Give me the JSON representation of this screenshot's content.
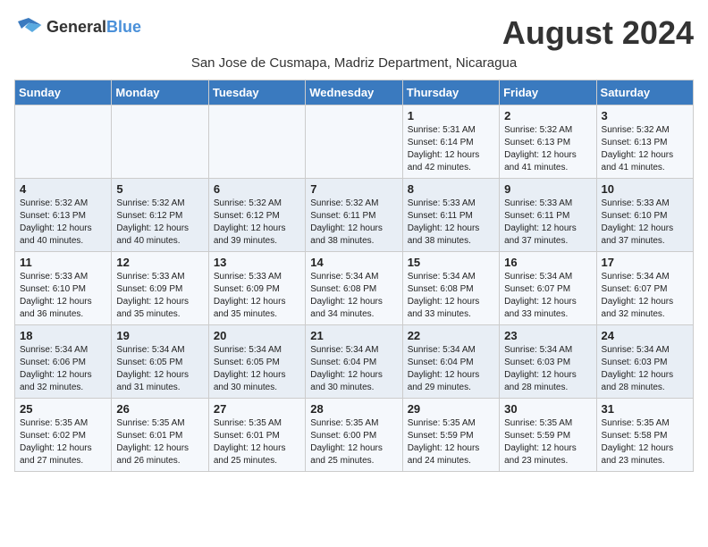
{
  "header": {
    "logo_general": "General",
    "logo_blue": "Blue",
    "month_title": "August 2024",
    "subtitle": "San Jose de Cusmapa, Madriz Department, Nicaragua"
  },
  "days_of_week": [
    "Sunday",
    "Monday",
    "Tuesday",
    "Wednesday",
    "Thursday",
    "Friday",
    "Saturday"
  ],
  "weeks": [
    [
      {
        "day": "",
        "info": ""
      },
      {
        "day": "",
        "info": ""
      },
      {
        "day": "",
        "info": ""
      },
      {
        "day": "",
        "info": ""
      },
      {
        "day": "1",
        "info": "Sunrise: 5:31 AM\nSunset: 6:14 PM\nDaylight: 12 hours\nand 42 minutes."
      },
      {
        "day": "2",
        "info": "Sunrise: 5:32 AM\nSunset: 6:13 PM\nDaylight: 12 hours\nand 41 minutes."
      },
      {
        "day": "3",
        "info": "Sunrise: 5:32 AM\nSunset: 6:13 PM\nDaylight: 12 hours\nand 41 minutes."
      }
    ],
    [
      {
        "day": "4",
        "info": "Sunrise: 5:32 AM\nSunset: 6:13 PM\nDaylight: 12 hours\nand 40 minutes."
      },
      {
        "day": "5",
        "info": "Sunrise: 5:32 AM\nSunset: 6:12 PM\nDaylight: 12 hours\nand 40 minutes."
      },
      {
        "day": "6",
        "info": "Sunrise: 5:32 AM\nSunset: 6:12 PM\nDaylight: 12 hours\nand 39 minutes."
      },
      {
        "day": "7",
        "info": "Sunrise: 5:32 AM\nSunset: 6:11 PM\nDaylight: 12 hours\nand 38 minutes."
      },
      {
        "day": "8",
        "info": "Sunrise: 5:33 AM\nSunset: 6:11 PM\nDaylight: 12 hours\nand 38 minutes."
      },
      {
        "day": "9",
        "info": "Sunrise: 5:33 AM\nSunset: 6:11 PM\nDaylight: 12 hours\nand 37 minutes."
      },
      {
        "day": "10",
        "info": "Sunrise: 5:33 AM\nSunset: 6:10 PM\nDaylight: 12 hours\nand 37 minutes."
      }
    ],
    [
      {
        "day": "11",
        "info": "Sunrise: 5:33 AM\nSunset: 6:10 PM\nDaylight: 12 hours\nand 36 minutes."
      },
      {
        "day": "12",
        "info": "Sunrise: 5:33 AM\nSunset: 6:09 PM\nDaylight: 12 hours\nand 35 minutes."
      },
      {
        "day": "13",
        "info": "Sunrise: 5:33 AM\nSunset: 6:09 PM\nDaylight: 12 hours\nand 35 minutes."
      },
      {
        "day": "14",
        "info": "Sunrise: 5:34 AM\nSunset: 6:08 PM\nDaylight: 12 hours\nand 34 minutes."
      },
      {
        "day": "15",
        "info": "Sunrise: 5:34 AM\nSunset: 6:08 PM\nDaylight: 12 hours\nand 33 minutes."
      },
      {
        "day": "16",
        "info": "Sunrise: 5:34 AM\nSunset: 6:07 PM\nDaylight: 12 hours\nand 33 minutes."
      },
      {
        "day": "17",
        "info": "Sunrise: 5:34 AM\nSunset: 6:07 PM\nDaylight: 12 hours\nand 32 minutes."
      }
    ],
    [
      {
        "day": "18",
        "info": "Sunrise: 5:34 AM\nSunset: 6:06 PM\nDaylight: 12 hours\nand 32 minutes."
      },
      {
        "day": "19",
        "info": "Sunrise: 5:34 AM\nSunset: 6:05 PM\nDaylight: 12 hours\nand 31 minutes."
      },
      {
        "day": "20",
        "info": "Sunrise: 5:34 AM\nSunset: 6:05 PM\nDaylight: 12 hours\nand 30 minutes."
      },
      {
        "day": "21",
        "info": "Sunrise: 5:34 AM\nSunset: 6:04 PM\nDaylight: 12 hours\nand 30 minutes."
      },
      {
        "day": "22",
        "info": "Sunrise: 5:34 AM\nSunset: 6:04 PM\nDaylight: 12 hours\nand 29 minutes."
      },
      {
        "day": "23",
        "info": "Sunrise: 5:34 AM\nSunset: 6:03 PM\nDaylight: 12 hours\nand 28 minutes."
      },
      {
        "day": "24",
        "info": "Sunrise: 5:34 AM\nSunset: 6:03 PM\nDaylight: 12 hours\nand 28 minutes."
      }
    ],
    [
      {
        "day": "25",
        "info": "Sunrise: 5:35 AM\nSunset: 6:02 PM\nDaylight: 12 hours\nand 27 minutes."
      },
      {
        "day": "26",
        "info": "Sunrise: 5:35 AM\nSunset: 6:01 PM\nDaylight: 12 hours\nand 26 minutes."
      },
      {
        "day": "27",
        "info": "Sunrise: 5:35 AM\nSunset: 6:01 PM\nDaylight: 12 hours\nand 25 minutes."
      },
      {
        "day": "28",
        "info": "Sunrise: 5:35 AM\nSunset: 6:00 PM\nDaylight: 12 hours\nand 25 minutes."
      },
      {
        "day": "29",
        "info": "Sunrise: 5:35 AM\nSunset: 5:59 PM\nDaylight: 12 hours\nand 24 minutes."
      },
      {
        "day": "30",
        "info": "Sunrise: 5:35 AM\nSunset: 5:59 PM\nDaylight: 12 hours\nand 23 minutes."
      },
      {
        "day": "31",
        "info": "Sunrise: 5:35 AM\nSunset: 5:58 PM\nDaylight: 12 hours\nand 23 minutes."
      }
    ]
  ]
}
